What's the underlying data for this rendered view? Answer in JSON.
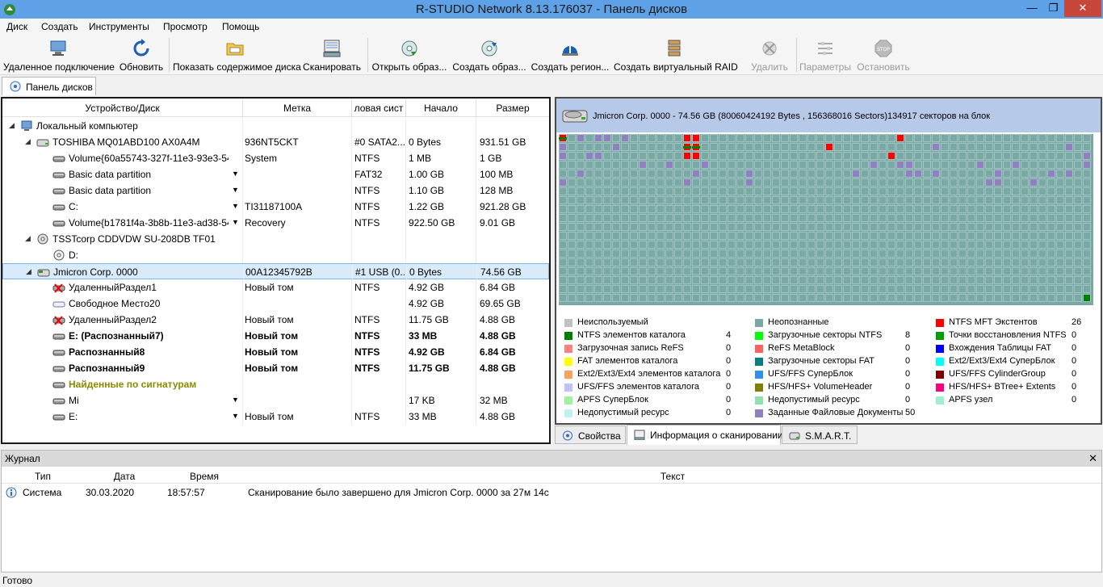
{
  "window": {
    "title": "R-STUDIO Network 8.13.176037 - Панель дисков"
  },
  "menu": [
    "Диск",
    "Создать",
    "Инструменты",
    "Просмотр",
    "Помощь"
  ],
  "toolbar": [
    {
      "label": "Удаленное подключение",
      "icon": "remote-connect-icon"
    },
    {
      "label": "Обновить",
      "icon": "refresh-icon"
    },
    {
      "label": "Показать содержимое диска",
      "icon": "show-files-icon"
    },
    {
      "label": "Сканировать",
      "icon": "scan-icon"
    },
    {
      "label": "Открыть образ...",
      "icon": "open-image-icon"
    },
    {
      "label": "Создать образ...",
      "icon": "create-image-icon"
    },
    {
      "label": "Создать регион...",
      "icon": "create-region-icon"
    },
    {
      "label": "Создать виртуальный RAID",
      "icon": "virtual-raid-icon"
    },
    {
      "label": "Удалить",
      "icon": "delete-icon"
    },
    {
      "label": "Параметры",
      "icon": "settings-icon"
    },
    {
      "label": "Остановить",
      "icon": "stop-icon"
    }
  ],
  "main_tab": "Панель дисков",
  "tree": {
    "columns": [
      "Устройство/Диск",
      "Метка",
      "ловая сист",
      "Начало",
      "Размер"
    ],
    "rows": [
      {
        "name": "Локальный компьютер",
        "label": "",
        "fs": "",
        "start": "",
        "size": ""
      },
      {
        "name": "TOSHIBA MQ01ABD100 AX0A4M",
        "label": "936NT5CKT",
        "fs": "#0 SATA2...",
        "start": "0 Bytes",
        "size": "931.51 GB"
      },
      {
        "name": "Volume{60a55743-327f-11e3-93e3-54...",
        "label": "System",
        "fs": "NTFS",
        "start": "1 MB",
        "size": "1 GB"
      },
      {
        "name": "Basic data partition",
        "label": "",
        "fs": "FAT32",
        "start": "1.00 GB",
        "size": "100 MB"
      },
      {
        "name": "Basic data partition",
        "label": "",
        "fs": "NTFS",
        "start": "1.10 GB",
        "size": "128 MB"
      },
      {
        "name": "C:",
        "label": "TI31187100A",
        "fs": "NTFS",
        "start": "1.22 GB",
        "size": "921.28 GB"
      },
      {
        "name": "Volume{b1781f4a-3b8b-11e3-ad38-54...",
        "label": "Recovery",
        "fs": "NTFS",
        "start": "922.50 GB",
        "size": "9.01 GB"
      },
      {
        "name": "TSSTcorp CDDVDW SU-208DB TF01",
        "label": "",
        "fs": "",
        "start": "",
        "size": ""
      },
      {
        "name": "D:",
        "label": "",
        "fs": "",
        "start": "",
        "size": ""
      },
      {
        "name": "Jmicron Corp. 0000",
        "label": "00A12345792B",
        "fs": "#1 USB (0...",
        "start": "0 Bytes",
        "size": "74.56 GB"
      },
      {
        "name": "УдаленныйРаздел1",
        "label": "Новый том",
        "fs": "NTFS",
        "start": "4.92 GB",
        "size": "6.84 GB"
      },
      {
        "name": "Свободное Место20",
        "label": "",
        "fs": "",
        "start": "4.92 GB",
        "size": "69.65 GB"
      },
      {
        "name": "УдаленныйРаздел2",
        "label": "Новый том",
        "fs": "NTFS",
        "start": "11.75 GB",
        "size": "4.88 GB"
      },
      {
        "name": "E: (Распознанный7)",
        "label": "Новый том",
        "fs": "NTFS",
        "start": "33 MB",
        "size": "4.88 GB"
      },
      {
        "name": "Распознанный8",
        "label": "Новый том",
        "fs": "NTFS",
        "start": "4.92 GB",
        "size": "6.84 GB"
      },
      {
        "name": "Распознанный9",
        "label": "Новый том",
        "fs": "NTFS",
        "start": "11.75 GB",
        "size": "4.88 GB"
      },
      {
        "name": "Найденные по сигнатурам",
        "label": "",
        "fs": "",
        "start": "",
        "size": ""
      },
      {
        "name": "Mi",
        "label": "",
        "fs": "",
        "start": "17 KB",
        "size": "32 MB"
      },
      {
        "name": "E:",
        "label": "Новый том",
        "fs": "NTFS",
        "start": "33 MB",
        "size": "4.88 GB"
      }
    ]
  },
  "map": {
    "header": "Jmicron Corp. 0000 - 74.56 GB (80060424192 Bytes , 156368016 Sectors)134917 секторов на блок",
    "legend": [
      {
        "text": "Неиспользуемый",
        "count": "",
        "color": "#c0c0c0"
      },
      {
        "text": "Неопознанные",
        "count": "",
        "color": "#7aa8a5"
      },
      {
        "text": "NTFS MFT Экстентов",
        "count": "26",
        "color": "#ff0000"
      },
      {
        "text": "NTFS элементов каталога",
        "count": "4",
        "color": "#008000"
      },
      {
        "text": "Загрузочные секторы NTFS",
        "count": "8",
        "color": "#00ff00"
      },
      {
        "text": "Точки восстановления NTFS",
        "count": "0",
        "color": "#00a000"
      },
      {
        "text": "Загрузочная запись ReFS",
        "count": "0",
        "color": "#ff8080"
      },
      {
        "text": "ReFS MetaBlock",
        "count": "0",
        "color": "#ff6060"
      },
      {
        "text": "Вхождения Таблицы FAT",
        "count": "0",
        "color": "#0000ff"
      },
      {
        "text": "FAT элементов каталога",
        "count": "0",
        "color": "#ffff00"
      },
      {
        "text": "Загрузочные секторы FAT",
        "count": "0",
        "color": "#008080"
      },
      {
        "text": "Ext2/Ext3/Ext4 СуперБлок",
        "count": "0",
        "color": "#00ffff"
      },
      {
        "text": "Ext2/Ext3/Ext4 элементов каталога",
        "count": "0",
        "color": "#ffa060"
      },
      {
        "text": "UFS/FFS СуперБлок",
        "count": "0",
        "color": "#3090f0"
      },
      {
        "text": "UFS/FFS CylinderGroup",
        "count": "0",
        "color": "#800000"
      },
      {
        "text": "UFS/FFS элементов каталога",
        "count": "0",
        "color": "#c0c0ff"
      },
      {
        "text": "HFS/HFS+ VolumeHeader",
        "count": "0",
        "color": "#808000"
      },
      {
        "text": "HFS/HFS+ BTree+ Extents",
        "count": "0",
        "color": "#ff0080"
      },
      {
        "text": "APFS СуперБлок",
        "count": "0",
        "color": "#a0f0a0"
      },
      {
        "text": "Недопустимый ресурс",
        "count": "0",
        "color": "#90e0b0"
      },
      {
        "text": "APFS узел",
        "count": "0",
        "color": "#a0f0d0"
      },
      {
        "text": "Недопустимый ресурс",
        "count": "0",
        "color": "#c0f0f0"
      },
      {
        "text": "Заданные Файловые Документы",
        "count": "50",
        "color": "#9080c0"
      }
    ]
  },
  "bottom_tabs": [
    "Свойства",
    "Информация о сканировании",
    "S.M.A.R.T."
  ],
  "journal": {
    "title": "Журнал",
    "columns": [
      "Тип",
      "Дата",
      "Время",
      "Текст"
    ],
    "rows": [
      {
        "type": "Система",
        "date": "30.03.2020",
        "time": "18:57:57",
        "text": "Сканирование было завершено для Jmicron Corp. 0000 за 27м 14с"
      }
    ]
  },
  "status": "Готово"
}
